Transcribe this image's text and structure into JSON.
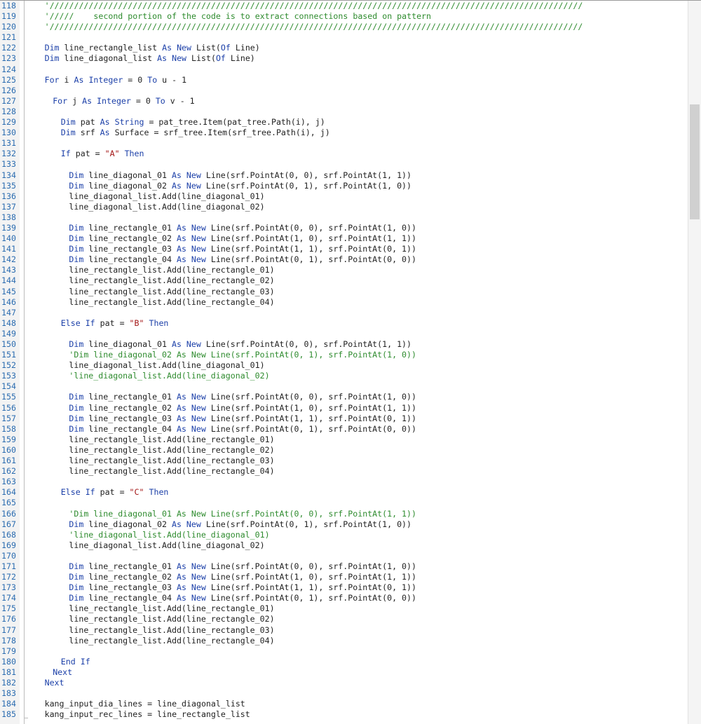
{
  "editor": {
    "lines": [
      {
        "n": "118",
        "indent": 2,
        "parts": [
          [
            "cm",
            "'/////////////////////////////////////////////////////////////////////////////////////////////////////////////"
          ]
        ]
      },
      {
        "n": "119",
        "indent": 2,
        "parts": [
          [
            "cm",
            "'/////    second portion of the code is to extract connections based on pattern"
          ]
        ]
      },
      {
        "n": "120",
        "indent": 2,
        "parts": [
          [
            "cm",
            "'/////////////////////////////////////////////////////////////////////////////////////////////////////////////"
          ]
        ]
      },
      {
        "n": "121",
        "indent": 0,
        "parts": []
      },
      {
        "n": "122",
        "indent": 2,
        "parts": [
          [
            "kw",
            "Dim"
          ],
          [
            "",
            " line_rectangle_list "
          ],
          [
            "kw",
            "As New"
          ],
          [
            "",
            " List("
          ],
          [
            "kw",
            "Of"
          ],
          [
            "",
            " Line)"
          ]
        ]
      },
      {
        "n": "123",
        "indent": 2,
        "parts": [
          [
            "kw",
            "Dim"
          ],
          [
            "",
            " line_diagonal_list "
          ],
          [
            "kw",
            "As New"
          ],
          [
            "",
            " List("
          ],
          [
            "kw",
            "Of"
          ],
          [
            "",
            " Line)"
          ]
        ]
      },
      {
        "n": "124",
        "indent": 0,
        "parts": []
      },
      {
        "n": "125",
        "indent": 2,
        "parts": [
          [
            "kw",
            "For"
          ],
          [
            "",
            " i "
          ],
          [
            "kw",
            "As Integer"
          ],
          [
            "",
            " = 0 "
          ],
          [
            "kw",
            "To"
          ],
          [
            "",
            " u - 1"
          ]
        ]
      },
      {
        "n": "126",
        "indent": 0,
        "parts": []
      },
      {
        "n": "127",
        "indent": 4,
        "parts": [
          [
            "kw",
            "For"
          ],
          [
            "",
            " j "
          ],
          [
            "kw",
            "As Integer"
          ],
          [
            "",
            " = 0 "
          ],
          [
            "kw",
            "To"
          ],
          [
            "",
            " v - 1"
          ]
        ]
      },
      {
        "n": "128",
        "indent": 0,
        "parts": []
      },
      {
        "n": "129",
        "indent": 6,
        "parts": [
          [
            "kw",
            "Dim"
          ],
          [
            "",
            " pat "
          ],
          [
            "kw",
            "As String"
          ],
          [
            "",
            " = pat_tree.Item(pat_tree.Path(i), j)"
          ]
        ]
      },
      {
        "n": "130",
        "indent": 6,
        "parts": [
          [
            "kw",
            "Dim"
          ],
          [
            "",
            " srf "
          ],
          [
            "kw",
            "As"
          ],
          [
            "",
            " Surface = srf_tree.Item(srf_tree.Path(i), j)"
          ]
        ]
      },
      {
        "n": "131",
        "indent": 0,
        "parts": []
      },
      {
        "n": "132",
        "indent": 6,
        "parts": [
          [
            "kw",
            "If"
          ],
          [
            "",
            " pat = "
          ],
          [
            "str",
            "\"A\""
          ],
          [
            "",
            " "
          ],
          [
            "kw",
            "Then"
          ]
        ]
      },
      {
        "n": "133",
        "indent": 0,
        "parts": []
      },
      {
        "n": "134",
        "indent": 8,
        "parts": [
          [
            "kw",
            "Dim"
          ],
          [
            "",
            " line_diagonal_01 "
          ],
          [
            "kw",
            "As New"
          ],
          [
            "",
            " Line(srf.PointAt(0, 0), srf.PointAt(1, 1))"
          ]
        ]
      },
      {
        "n": "135",
        "indent": 8,
        "parts": [
          [
            "kw",
            "Dim"
          ],
          [
            "",
            " line_diagonal_02 "
          ],
          [
            "kw",
            "As New"
          ],
          [
            "",
            " Line(srf.PointAt(0, 1), srf.PointAt(1, 0))"
          ]
        ]
      },
      {
        "n": "136",
        "indent": 8,
        "parts": [
          [
            "",
            "line_diagonal_list.Add(line_diagonal_01)"
          ]
        ]
      },
      {
        "n": "137",
        "indent": 8,
        "parts": [
          [
            "",
            "line_diagonal_list.Add(line_diagonal_02)"
          ]
        ]
      },
      {
        "n": "138",
        "indent": 0,
        "parts": []
      },
      {
        "n": "139",
        "indent": 8,
        "parts": [
          [
            "kw",
            "Dim"
          ],
          [
            "",
            " line_rectangle_01 "
          ],
          [
            "kw",
            "As New"
          ],
          [
            "",
            " Line(srf.PointAt(0, 0), srf.PointAt(1, 0))"
          ]
        ]
      },
      {
        "n": "140",
        "indent": 8,
        "parts": [
          [
            "kw",
            "Dim"
          ],
          [
            "",
            " line_rectangle_02 "
          ],
          [
            "kw",
            "As New"
          ],
          [
            "",
            " Line(srf.PointAt(1, 0), srf.PointAt(1, 1))"
          ]
        ]
      },
      {
        "n": "141",
        "indent": 8,
        "parts": [
          [
            "kw",
            "Dim"
          ],
          [
            "",
            " line_rectangle_03 "
          ],
          [
            "kw",
            "As New"
          ],
          [
            "",
            " Line(srf.PointAt(1, 1), srf.PointAt(0, 1))"
          ]
        ]
      },
      {
        "n": "142",
        "indent": 8,
        "parts": [
          [
            "kw",
            "Dim"
          ],
          [
            "",
            " line_rectangle_04 "
          ],
          [
            "kw",
            "As New"
          ],
          [
            "",
            " Line(srf.PointAt(0, 1), srf.PointAt(0, 0))"
          ]
        ]
      },
      {
        "n": "143",
        "indent": 8,
        "parts": [
          [
            "",
            "line_rectangle_list.Add(line_rectangle_01)"
          ]
        ]
      },
      {
        "n": "144",
        "indent": 8,
        "parts": [
          [
            "",
            "line_rectangle_list.Add(line_rectangle_02)"
          ]
        ]
      },
      {
        "n": "145",
        "indent": 8,
        "parts": [
          [
            "",
            "line_rectangle_list.Add(line_rectangle_03)"
          ]
        ]
      },
      {
        "n": "146",
        "indent": 8,
        "parts": [
          [
            "",
            "line_rectangle_list.Add(line_rectangle_04)"
          ]
        ]
      },
      {
        "n": "147",
        "indent": 0,
        "parts": []
      },
      {
        "n": "148",
        "indent": 6,
        "parts": [
          [
            "kw",
            "Else If"
          ],
          [
            "",
            " pat = "
          ],
          [
            "str",
            "\"B\""
          ],
          [
            "",
            " "
          ],
          [
            "kw",
            "Then"
          ]
        ]
      },
      {
        "n": "149",
        "indent": 0,
        "parts": []
      },
      {
        "n": "150",
        "indent": 8,
        "parts": [
          [
            "kw",
            "Dim"
          ],
          [
            "",
            " line_diagonal_01 "
          ],
          [
            "kw",
            "As New"
          ],
          [
            "",
            " Line(srf.PointAt(0, 0), srf.PointAt(1, 1))"
          ]
        ]
      },
      {
        "n": "151",
        "indent": 8,
        "parts": [
          [
            "cm",
            "'Dim line_diagonal_02 As New Line(srf.PointAt(0, 1), srf.PointAt(1, 0))"
          ]
        ]
      },
      {
        "n": "152",
        "indent": 8,
        "parts": [
          [
            "",
            "line_diagonal_list.Add(line_diagonal_01)"
          ]
        ]
      },
      {
        "n": "153",
        "indent": 8,
        "parts": [
          [
            "cm",
            "'line_diagonal_list.Add(line_diagonal_02)"
          ]
        ]
      },
      {
        "n": "154",
        "indent": 0,
        "parts": []
      },
      {
        "n": "155",
        "indent": 8,
        "parts": [
          [
            "kw",
            "Dim"
          ],
          [
            "",
            " line_rectangle_01 "
          ],
          [
            "kw",
            "As New"
          ],
          [
            "",
            " Line(srf.PointAt(0, 0), srf.PointAt(1, 0))"
          ]
        ]
      },
      {
        "n": "156",
        "indent": 8,
        "parts": [
          [
            "kw",
            "Dim"
          ],
          [
            "",
            " line_rectangle_02 "
          ],
          [
            "kw",
            "As New"
          ],
          [
            "",
            " Line(srf.PointAt(1, 0), srf.PointAt(1, 1))"
          ]
        ]
      },
      {
        "n": "157",
        "indent": 8,
        "parts": [
          [
            "kw",
            "Dim"
          ],
          [
            "",
            " line_rectangle_03 "
          ],
          [
            "kw",
            "As New"
          ],
          [
            "",
            " Line(srf.PointAt(1, 1), srf.PointAt(0, 1))"
          ]
        ]
      },
      {
        "n": "158",
        "indent": 8,
        "parts": [
          [
            "kw",
            "Dim"
          ],
          [
            "",
            " line_rectangle_04 "
          ],
          [
            "kw",
            "As New"
          ],
          [
            "",
            " Line(srf.PointAt(0, 1), srf.PointAt(0, 0))"
          ]
        ]
      },
      {
        "n": "159",
        "indent": 8,
        "parts": [
          [
            "",
            "line_rectangle_list.Add(line_rectangle_01)"
          ]
        ]
      },
      {
        "n": "160",
        "indent": 8,
        "parts": [
          [
            "",
            "line_rectangle_list.Add(line_rectangle_02)"
          ]
        ]
      },
      {
        "n": "161",
        "indent": 8,
        "parts": [
          [
            "",
            "line_rectangle_list.Add(line_rectangle_03)"
          ]
        ]
      },
      {
        "n": "162",
        "indent": 8,
        "parts": [
          [
            "",
            "line_rectangle_list.Add(line_rectangle_04)"
          ]
        ]
      },
      {
        "n": "163",
        "indent": 0,
        "parts": []
      },
      {
        "n": "164",
        "indent": 6,
        "parts": [
          [
            "kw",
            "Else If"
          ],
          [
            "",
            " pat = "
          ],
          [
            "str",
            "\"C\""
          ],
          [
            "",
            " "
          ],
          [
            "kw",
            "Then"
          ]
        ]
      },
      {
        "n": "165",
        "indent": 0,
        "parts": []
      },
      {
        "n": "166",
        "indent": 8,
        "parts": [
          [
            "cm",
            "'Dim line_diagonal_01 As New Line(srf.PointAt(0, 0), srf.PointAt(1, 1))"
          ]
        ]
      },
      {
        "n": "167",
        "indent": 8,
        "parts": [
          [
            "kw",
            "Dim"
          ],
          [
            "",
            " line_diagonal_02 "
          ],
          [
            "kw",
            "As New"
          ],
          [
            "",
            " Line(srf.PointAt(0, 1), srf.PointAt(1, 0))"
          ]
        ]
      },
      {
        "n": "168",
        "indent": 8,
        "parts": [
          [
            "cm",
            "'line_diagonal_list.Add(line_diagonal_01)"
          ]
        ]
      },
      {
        "n": "169",
        "indent": 8,
        "parts": [
          [
            "",
            "line_diagonal_list.Add(line_diagonal_02)"
          ]
        ]
      },
      {
        "n": "170",
        "indent": 0,
        "parts": []
      },
      {
        "n": "171",
        "indent": 8,
        "parts": [
          [
            "kw",
            "Dim"
          ],
          [
            "",
            " line_rectangle_01 "
          ],
          [
            "kw",
            "As New"
          ],
          [
            "",
            " Line(srf.PointAt(0, 0), srf.PointAt(1, 0))"
          ]
        ]
      },
      {
        "n": "172",
        "indent": 8,
        "parts": [
          [
            "kw",
            "Dim"
          ],
          [
            "",
            " line_rectangle_02 "
          ],
          [
            "kw",
            "As New"
          ],
          [
            "",
            " Line(srf.PointAt(1, 0), srf.PointAt(1, 1))"
          ]
        ]
      },
      {
        "n": "173",
        "indent": 8,
        "parts": [
          [
            "kw",
            "Dim"
          ],
          [
            "",
            " line_rectangle_03 "
          ],
          [
            "kw",
            "As New"
          ],
          [
            "",
            " Line(srf.PointAt(1, 1), srf.PointAt(0, 1))"
          ]
        ]
      },
      {
        "n": "174",
        "indent": 8,
        "parts": [
          [
            "kw",
            "Dim"
          ],
          [
            "",
            " line_rectangle_04 "
          ],
          [
            "kw",
            "As New"
          ],
          [
            "",
            " Line(srf.PointAt(0, 1), srf.PointAt(0, 0))"
          ]
        ]
      },
      {
        "n": "175",
        "indent": 8,
        "parts": [
          [
            "",
            "line_rectangle_list.Add(line_rectangle_01)"
          ]
        ]
      },
      {
        "n": "176",
        "indent": 8,
        "parts": [
          [
            "",
            "line_rectangle_list.Add(line_rectangle_02)"
          ]
        ]
      },
      {
        "n": "177",
        "indent": 8,
        "parts": [
          [
            "",
            "line_rectangle_list.Add(line_rectangle_03)"
          ]
        ]
      },
      {
        "n": "178",
        "indent": 8,
        "parts": [
          [
            "",
            "line_rectangle_list.Add(line_rectangle_04)"
          ]
        ]
      },
      {
        "n": "179",
        "indent": 0,
        "parts": []
      },
      {
        "n": "180",
        "indent": 6,
        "parts": [
          [
            "kw",
            "End If"
          ]
        ]
      },
      {
        "n": "181",
        "indent": 4,
        "parts": [
          [
            "kw",
            "Next"
          ]
        ]
      },
      {
        "n": "182",
        "indent": 2,
        "parts": [
          [
            "kw",
            "Next"
          ]
        ]
      },
      {
        "n": "183",
        "indent": 0,
        "parts": []
      },
      {
        "n": "184",
        "indent": 2,
        "parts": [
          [
            "",
            "kang_input_dia_lines = line_diagonal_list"
          ]
        ]
      },
      {
        "n": "185",
        "indent": 2,
        "parts": [
          [
            "",
            "kang_input_rec_lines = line_rectangle_list"
          ]
        ]
      }
    ]
  },
  "colors": {
    "keyword": "#1b3fa8",
    "string": "#a31515",
    "comment": "#2e8b2e",
    "line_number": "#2b6cb0",
    "text": "#222222"
  }
}
